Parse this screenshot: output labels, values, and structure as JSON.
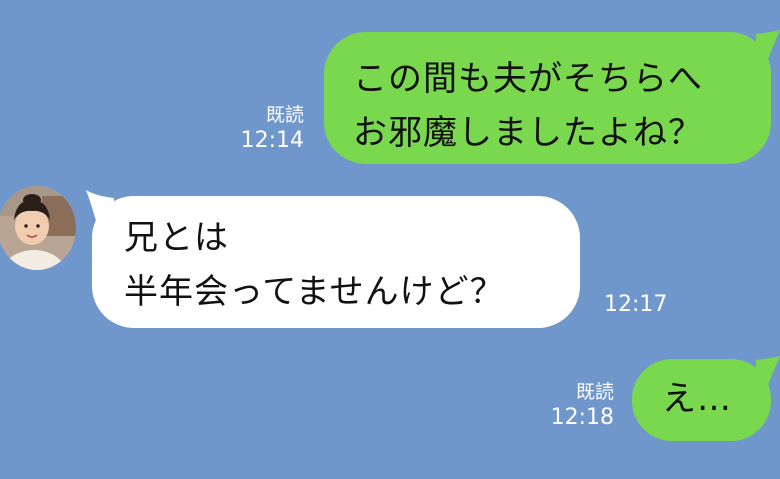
{
  "messages": [
    {
      "direction": "outgoing",
      "lines": [
        "この間も夫がそちらへ",
        "お邪魔しましたよね？"
      ],
      "read_label": "既読",
      "time": "12:14"
    },
    {
      "direction": "incoming",
      "avatar_icon": "child-avatar-icon",
      "lines": [
        "兄とは",
        "半年会ってませんけど？"
      ],
      "time": "12:17"
    },
    {
      "direction": "outgoing",
      "lines": [
        "え…"
      ],
      "read_label": "既読",
      "time": "12:18"
    }
  ],
  "colors": {
    "background": "#6f97cc",
    "outgoing_bubble": "#7ad84f",
    "incoming_bubble": "#ffffff",
    "meta_text": "#ffffff"
  }
}
